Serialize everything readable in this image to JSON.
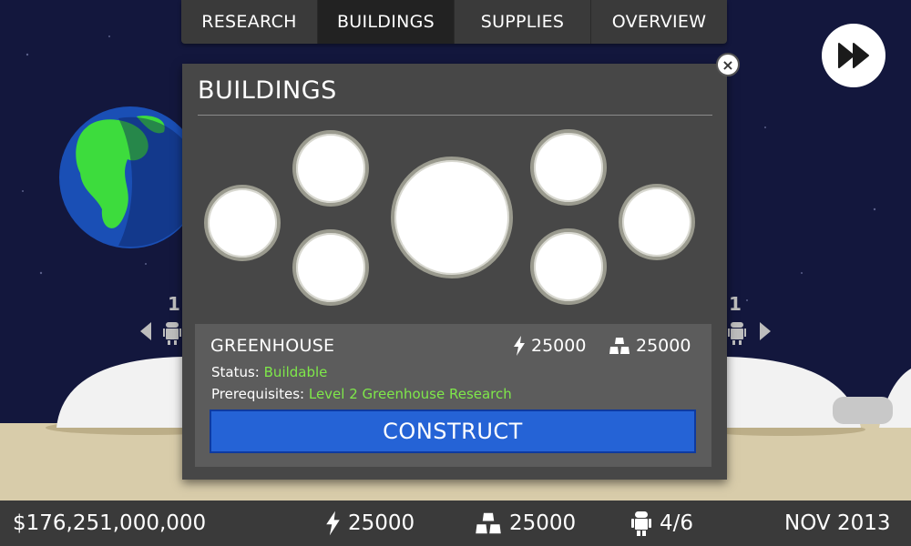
{
  "tabs": [
    {
      "label": "RESEARCH"
    },
    {
      "label": "BUILDINGS"
    },
    {
      "label": "SUPPLIES"
    },
    {
      "label": "OVERVIEW"
    }
  ],
  "active_tab": 1,
  "side_counters": {
    "left": "1",
    "right": "1"
  },
  "modal": {
    "title": "BUILDINGS",
    "close_symbol": "×",
    "building": {
      "name": "GREENHOUSE",
      "energy_cost": "25000",
      "metal_cost": "25000",
      "status_label": "Status:",
      "status_value": "Buildable",
      "prereq_label": "Prerequisites:",
      "prereq_value": "Level 2 Greenhouse Research"
    },
    "construct_label": "CONSTRUCT"
  },
  "bottom_bar": {
    "money": "$176,251,000,000",
    "energy": "25000",
    "metal": "25000",
    "robots": "4/6",
    "date": "NOV 2013"
  },
  "colors": {
    "accent_blue": "#2563d6",
    "status_green": "#7fe84a",
    "panel": "#474747",
    "bar": "#3a3a3a"
  },
  "icons": [
    "fast-forward-icon",
    "lightning-icon",
    "metal-bars-icon",
    "robot-icon",
    "arrow-left-icon",
    "arrow-right-icon",
    "close-icon"
  ]
}
